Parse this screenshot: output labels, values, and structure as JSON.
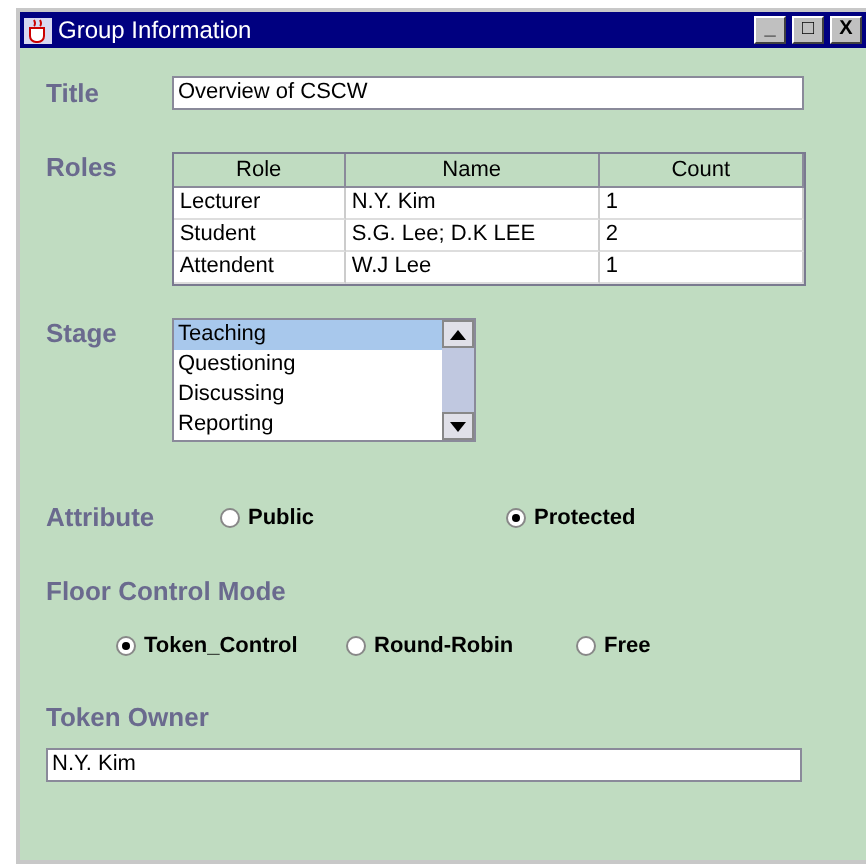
{
  "window": {
    "title": "Group Information",
    "controls": [
      "_",
      "□",
      "X"
    ]
  },
  "title_field": {
    "label": "Title",
    "value": "Overview of CSCW"
  },
  "roles": {
    "label": "Roles",
    "columns": [
      "Role",
      "Name",
      "Count"
    ],
    "rows": [
      [
        "Lecturer",
        "N.Y. Kim",
        "1"
      ],
      [
        "Student",
        "S.G. Lee; D.K LEE",
        "2"
      ],
      [
        "Attendent",
        "W.J Lee",
        "1"
      ]
    ]
  },
  "stage": {
    "label": "Stage",
    "items": [
      {
        "label": "Teaching",
        "selected": true
      },
      {
        "label": "Questioning",
        "selected": false
      },
      {
        "label": "Discussing",
        "selected": false
      },
      {
        "label": "Reporting",
        "selected": false
      }
    ]
  },
  "attribute": {
    "label": "Attribute",
    "options": [
      {
        "label": "Public",
        "selected": false
      },
      {
        "label": "Protected",
        "selected": true
      }
    ]
  },
  "floor_control": {
    "label": "Floor Control Mode",
    "options": [
      {
        "label": "Token_Control",
        "selected": true
      },
      {
        "label": "Round-Robin",
        "selected": false
      },
      {
        "label": "Free",
        "selected": false
      }
    ]
  },
  "token_owner": {
    "label": "Token Owner",
    "value": "N.Y. Kim"
  }
}
